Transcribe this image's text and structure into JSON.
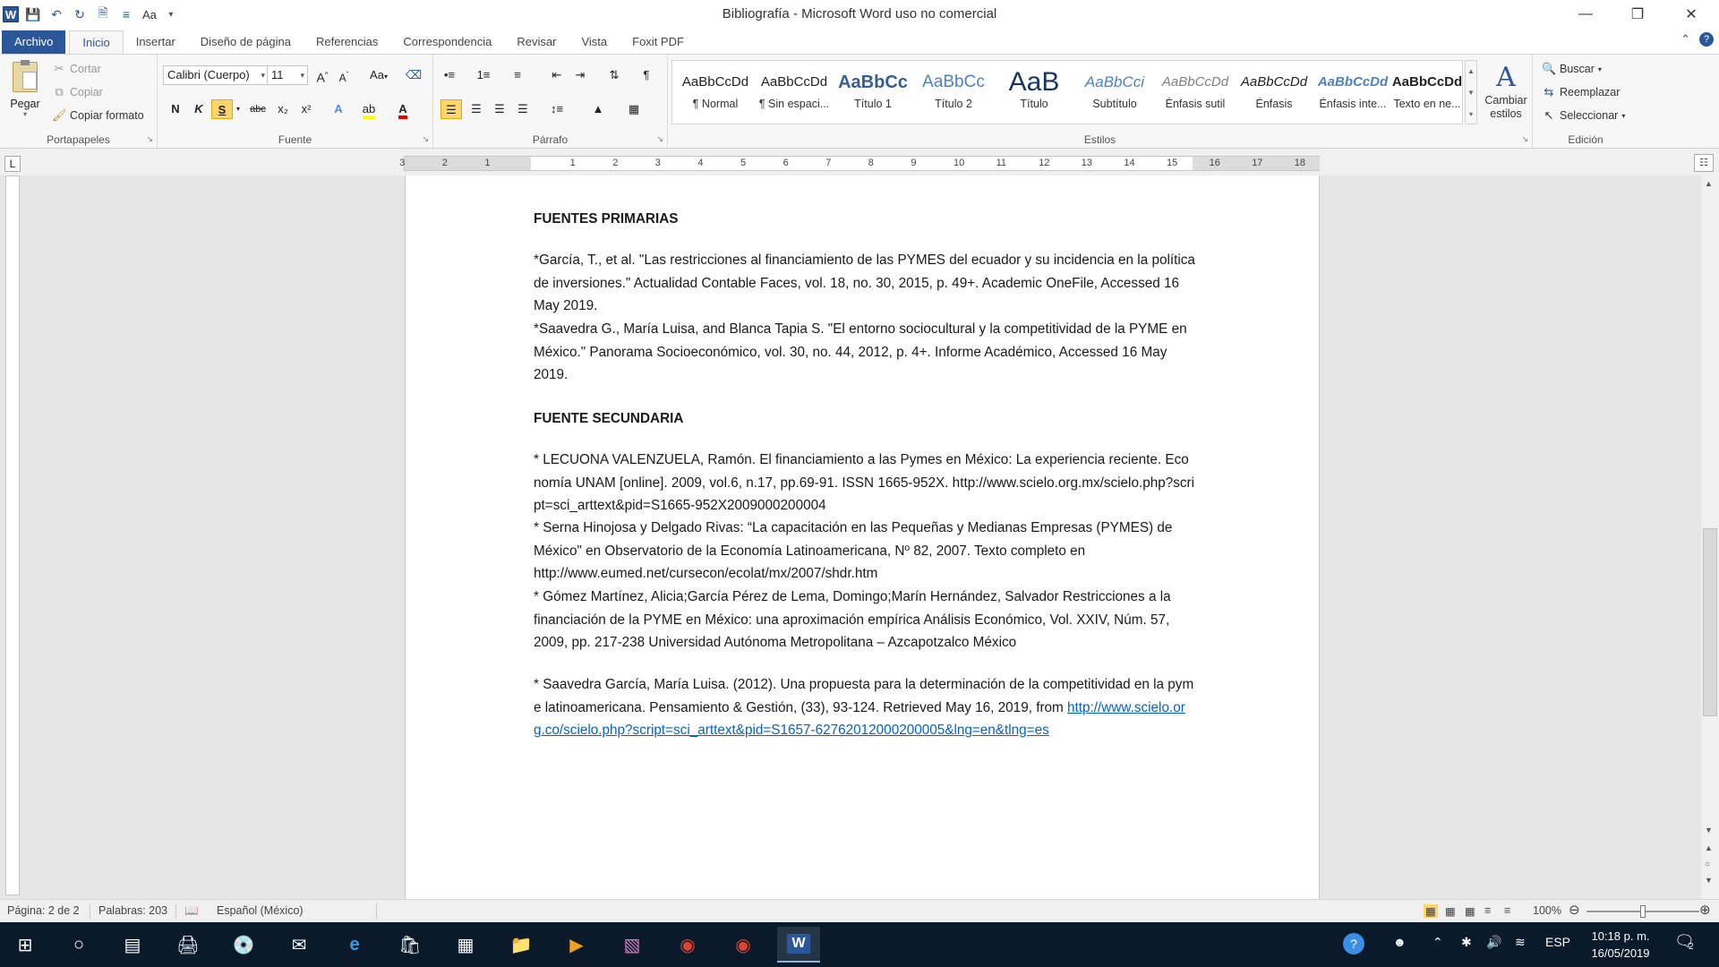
{
  "window": {
    "title": "Bibliografía - Microsoft Word uso no comercial",
    "app_icon_letter": "W",
    "qat_font_label": "Aa",
    "controls": {
      "minimize": "—",
      "restore": "❐",
      "close": "✕"
    }
  },
  "tabs": [
    {
      "label": "Archivo"
    },
    {
      "label": "Inicio"
    },
    {
      "label": "Insertar"
    },
    {
      "label": "Diseño de página"
    },
    {
      "label": "Referencias"
    },
    {
      "label": "Correspondencia"
    },
    {
      "label": "Revisar"
    },
    {
      "label": "Vista"
    },
    {
      "label": "Foxit PDF"
    }
  ],
  "ribbon": {
    "clipboard": {
      "paste": "Pegar",
      "cut": "Cortar",
      "copy": "Copiar",
      "format_painter": "Copiar formato",
      "label": "Portapapeles"
    },
    "font": {
      "font_name": "Calibri (Cuerpo)",
      "font_size": "11",
      "bold": "N",
      "italic": "K",
      "underline": "S",
      "strike": "abc",
      "subscript": "x₂",
      "superscript": "x²",
      "change_case": "Aa",
      "label": "Fuente"
    },
    "paragraph": {
      "label": "Párrafo",
      "pilcrow": "¶"
    },
    "styles": {
      "items": [
        {
          "sample": "AaBbCcDd",
          "name": "¶ Normal"
        },
        {
          "sample": "AaBbCcDd",
          "name": "¶ Sin espaci..."
        },
        {
          "sample": "AaBbCc",
          "name": "Título 1"
        },
        {
          "sample": "AaBbCc",
          "name": "Título 2"
        },
        {
          "sample": "AaB",
          "name": "Título"
        },
        {
          "sample": "AaBbCci",
          "name": "Subtítulo"
        },
        {
          "sample": "AaBbCcDd",
          "name": "Énfasis sutil"
        },
        {
          "sample": "AaBbCcDd",
          "name": "Énfasis"
        },
        {
          "sample": "AaBbCcDd",
          "name": "Énfasis inte..."
        },
        {
          "sample": "AaBbCcDd",
          "name": "Texto en ne..."
        }
      ],
      "change_styles": "Cambiar estilos",
      "label": "Estilos"
    },
    "editing": {
      "find": "Buscar",
      "replace": "Reemplazar",
      "select": "Seleccionar",
      "label": "Edición"
    }
  },
  "ruler": {
    "numbers": [
      "3",
      "2",
      "1",
      "1",
      "2",
      "3",
      "4",
      "5",
      "6",
      "7",
      "8",
      "9",
      "10",
      "11",
      "12",
      "13",
      "14",
      "15",
      "16",
      "17",
      "18"
    ],
    "tab_selector": "L"
  },
  "document": {
    "heading_primary": "FUENTES PRIMARIAS",
    "primary": [
      "*García, T., et al. \"Las restricciones al financiamiento de las PYMES del ecuador y su incidencia en la política de inversiones.\" Actualidad Contable Faces, vol. 18, no. 30, 2015, p. 49+. Academic OneFile, Accessed 16 May 2019.",
      "*Saavedra G., María Luisa, and Blanca Tapia S. \"El entorno sociocultural y la competitividad de la PYME en México.\" Panorama Socioeconómico, vol. 30, no. 44, 2012, p. 4+. Informe Académico, Accessed 16 May 2019."
    ],
    "heading_secondary": "FUENTE SECUNDARIA",
    "secondary": [
      " * LECUONA VALENZUELA, Ramón. El financiamiento a las Pymes en México: La experiencia reciente. Economía UNAM [online]. 2009, vol.6, n.17, pp.69-91. ISSN 1665-952X. http://www.scielo.org.mx/scielo.php?script=sci_arttext&pid=S1665-952X2009000200004",
      "* Serna Hinojosa y Delgado Rivas: “La capacitación en las Pequeñas y Medianas Empresas (PYMES) de México\" en Observatorio de la Economía Latinoamericana, Nº 82, 2007. Texto completo en http://www.eumed.net/cursecon/ecolat/mx/2007/shdr.htm",
      "* Gómez Martínez, Alicia;García Pérez de Lema, Domingo;Marín Hernández, Salvador Restricciones a la financiación de la PYME en México: una aproximación empírica Análisis Económico, Vol. XXIV, Núm. 57, 2009, pp. 217-238 Universidad Autónoma Metropolitana – Azcapotzalco México"
    ],
    "last_entry_text": "* Saavedra García, María Luisa. (2012). Una propuesta para la determinación de la competitividad en la pyme latinoamericana. Pensamiento & Gestión, (33), 93-124. Retrieved May 16, 2019, from ",
    "last_entry_link": "http://www.scielo.org.co/scielo.php?script=sci_arttext&pid=S1657-62762012000200005&lng=en&tlng=es"
  },
  "status": {
    "page": "Página: 2 de 2",
    "words": "Palabras: 203",
    "language": "Español (México)",
    "zoom": "100%",
    "zoom_level": 0.5
  },
  "taskbar": {
    "language": "ESP",
    "time": "10:18 p. m.",
    "date": "16/05/2019",
    "notifications": "2"
  },
  "colors": {
    "accent": "#2b579a",
    "highlight": "#fcd66f",
    "link": "#0563c1",
    "taskbar": "#0b1a2b"
  }
}
